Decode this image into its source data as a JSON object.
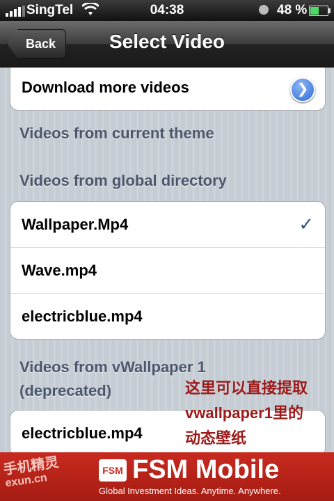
{
  "status_bar": {
    "carrier": "SingTel",
    "time": "04:38",
    "battery_percent": "48 %",
    "wifi_icon": "wifi-icon",
    "battery_level": 0.48
  },
  "nav": {
    "back_label": "Back",
    "title": "Select Video"
  },
  "groups": {
    "top": {
      "label": "Download more videos",
      "icon": "chevron-right-icon"
    },
    "header_theme": "Videos from current theme",
    "header_global": "Videos from global directory",
    "global_items": [
      {
        "label": "Wallpaper.Mp4",
        "checked": true
      },
      {
        "label": "Wave.mp4",
        "checked": false
      },
      {
        "label": "electricblue.mp4",
        "checked": false
      }
    ],
    "header_vwallpaper_line1": "Videos from vWallpaper 1",
    "header_vwallpaper_line2": "(deprecated)",
    "vwallpaper_items": [
      {
        "label": "electricblue.mp4"
      }
    ]
  },
  "annotation": {
    "line1": "这里可以直接提取",
    "line2": "vwallpaper1里的",
    "line3": "动态壁纸"
  },
  "banner": {
    "left_logo": "手机精灵",
    "left_logo_sub": "exun.cn",
    "badge": "FSM",
    "brand": "FSM Mobile",
    "tagline": "Global Investment Ideas. Anytime. Anywhere."
  }
}
